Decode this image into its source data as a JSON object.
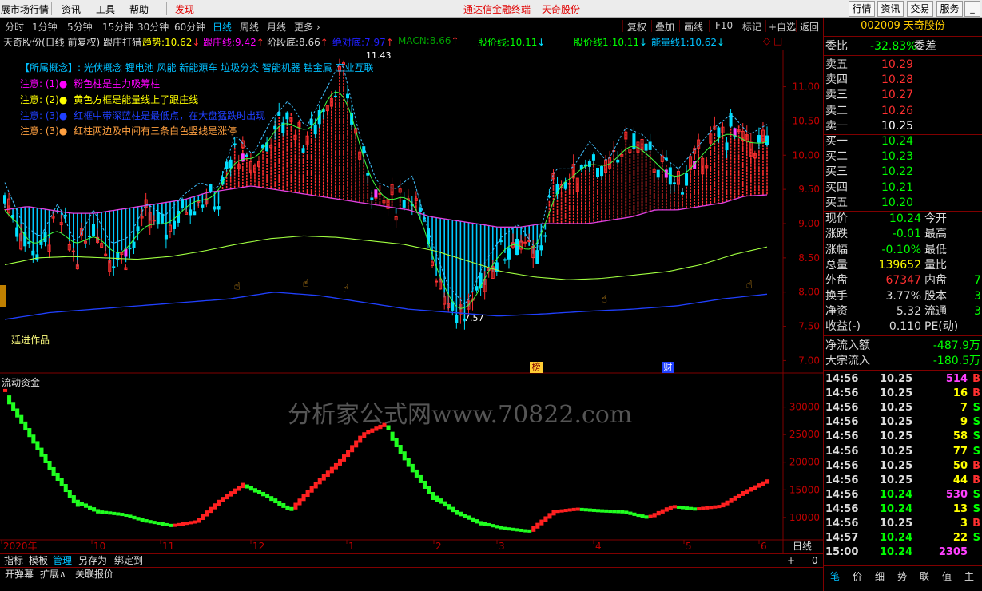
{
  "menubar": {
    "items": [
      "展市场行情",
      "资讯",
      "工具",
      "帮助",
      "发现"
    ],
    "center_title": "通达信金融终端",
    "stock_title": "天奇股份",
    "right_buttons": [
      "行情",
      "资讯",
      "交易",
      "服务"
    ],
    "window_controls": [
      "_",
      "□",
      "×"
    ]
  },
  "toolbar": {
    "periods": [
      "分时",
      "1分钟",
      "5分钟",
      "15分钟",
      "30分钟",
      "60分钟",
      "日线",
      "周线",
      "月线",
      "更多 ›"
    ],
    "active_period": "日线",
    "right": [
      "复权",
      "叠加",
      "画线",
      "F10",
      "标记",
      "+自选",
      "返回"
    ]
  },
  "indicator_line": {
    "name": "天奇股份(日线 前复权) 跟庄打猎",
    "items": [
      {
        "label": "趋势:",
        "value": "10.62",
        "arrow": "↓"
      },
      {
        "label": "跟庄线:",
        "value": "9.42",
        "arrow": "↑"
      },
      {
        "label": "阶段底:",
        "value": "8.66",
        "arrow": "↑"
      },
      {
        "label": "绝对底:",
        "value": "7.97",
        "arrow": "↑"
      },
      {
        "label": "MACN:",
        "value": "8.66",
        "arrow": "↑"
      },
      {
        "label": "股价线:",
        "value": "10.11",
        "arrow": "↓"
      },
      {
        "label": "股价线1:",
        "value": "10.11",
        "arrow": "↓"
      },
      {
        "label": "能量线1:",
        "value": "10.62",
        "arrow": "↓"
      }
    ]
  },
  "notes": {
    "concepts": "【所属概念】: 光伏概念 锂电池 风能 新能源车 垃圾分类 智能机器 钴金属 工业互联",
    "n1": "注意: (1)●",
    "t1": "粉色柱是主力吸筹柱",
    "n2": "注意: (2)●",
    "t2": "黄色方框是能量线上了跟庄线",
    "n3": "注意: (3)●",
    "t3": "红框中带深蓝柱是最低点，在大盘猛跌时出现",
    "n4": "注意: (3)●",
    "t4": "红柱两边及中间有三条白色竖线是涨停",
    "author": "廷进作品"
  },
  "main_chart": {
    "y_ticks": [
      "11.00",
      "10.50",
      "10.00",
      "9.50",
      "9.00",
      "8.50",
      "8.00",
      "7.50",
      "7.00"
    ],
    "y_range": [
      6.9,
      11.45
    ],
    "high_label": "11.43",
    "low_label": "7.57",
    "markers": [
      "榜",
      "财"
    ]
  },
  "sub_chart": {
    "title": "流动资金",
    "y_ticks": [
      "30000",
      "25000",
      "20000",
      "15000",
      "10000"
    ],
    "y_range": [
      6500,
      34000
    ],
    "watermark": "分析家公式网www.70822.com"
  },
  "x_axis": {
    "labels": [
      "2020年",
      "10",
      "11",
      "12",
      "1",
      "2",
      "3",
      "4",
      "5",
      "6"
    ],
    "period": "日线"
  },
  "bottom_tabs": [
    "指标",
    "模板",
    "管理",
    "另存为",
    "绑定到"
  ],
  "bottom_tabs2": [
    "开弹幕",
    "扩展∧",
    "关联报价"
  ],
  "zoom_controls": [
    "+",
    "-",
    "0"
  ],
  "quote": {
    "code": "002009",
    "name": "天奇股份",
    "weibi_label": "委比",
    "weibi": "-32.83%",
    "weicha_label": "委差",
    "asks": [
      {
        "label": "卖五",
        "price": "10.29"
      },
      {
        "label": "卖四",
        "price": "10.28"
      },
      {
        "label": "卖三",
        "price": "10.27"
      },
      {
        "label": "卖二",
        "price": "10.26"
      },
      {
        "label": "卖一",
        "price": "10.25"
      }
    ],
    "bids": [
      {
        "label": "买一",
        "price": "10.24"
      },
      {
        "label": "买二",
        "price": "10.23"
      },
      {
        "label": "买三",
        "price": "10.22"
      },
      {
        "label": "买四",
        "price": "10.21"
      },
      {
        "label": "买五",
        "price": "10.20"
      }
    ],
    "stats": [
      {
        "l": "现价",
        "v": "10.24",
        "l2": "今开",
        "v2": ""
      },
      {
        "l": "涨跌",
        "v": "-0.01",
        "l2": "最高",
        "v2": ""
      },
      {
        "l": "涨幅",
        "v": "-0.10%",
        "l2": "最低",
        "v2": ""
      },
      {
        "l": "总量",
        "v": "139652",
        "l2": "量比",
        "v2": ""
      },
      {
        "l": "外盘",
        "v": "67347",
        "l2": "内盘",
        "v2": "7"
      },
      {
        "l": "换手",
        "v": "3.77%",
        "l2": "股本",
        "v2": "3."
      },
      {
        "l": "净资",
        "v": "5.32",
        "l2": "流通",
        "v2": "3."
      },
      {
        "l": "收益(-)",
        "v": "0.110",
        "l2": "PE(动)",
        "v2": ""
      }
    ],
    "netflow_label": "净流入额",
    "netflow": "-487.9万",
    "block_label": "大宗流入",
    "block": "-180.5万",
    "ticks": [
      {
        "t": "14:56",
        "p": "10.25",
        "v": "514",
        "d": "B"
      },
      {
        "t": "14:56",
        "p": "10.25",
        "v": "16",
        "d": "B"
      },
      {
        "t": "14:56",
        "p": "10.25",
        "v": "7",
        "d": "S"
      },
      {
        "t": "14:56",
        "p": "10.25",
        "v": "9",
        "d": "S"
      },
      {
        "t": "14:56",
        "p": "10.25",
        "v": "58",
        "d": "S"
      },
      {
        "t": "14:56",
        "p": "10.25",
        "v": "77",
        "d": "S"
      },
      {
        "t": "14:56",
        "p": "10.25",
        "v": "50",
        "d": "B"
      },
      {
        "t": "14:56",
        "p": "10.25",
        "v": "44",
        "d": "B"
      },
      {
        "t": "14:56",
        "p": "10.24",
        "v": "530",
        "d": "S"
      },
      {
        "t": "14:56",
        "p": "10.24",
        "v": "13",
        "d": "S"
      },
      {
        "t": "14:56",
        "p": "10.25",
        "v": "3",
        "d": "B"
      },
      {
        "t": "14:57",
        "p": "10.24",
        "v": "22",
        "d": "S"
      },
      {
        "t": "15:00",
        "p": "10.24",
        "v": "2305",
        "d": ""
      }
    ],
    "bottom_tabs": [
      "笔",
      "价",
      "细",
      "势",
      "联",
      "值",
      "主"
    ]
  },
  "colors": {
    "up": "#ff3030",
    "down": "#00e0ff",
    "green": "#00ff00",
    "yellow": "#ffff00",
    "magenta": "#ff00ff",
    "white": "#ffffff",
    "grid": "#800000"
  },
  "chart_data": {
    "type": "line",
    "title": "天奇股份(日线 前复权)",
    "series": [
      {
        "name": "股价线",
        "values": [
          9.4,
          8.8,
          8.6,
          9.1,
          8.5,
          9.0,
          8.5,
          8.6,
          9.1,
          8.9,
          9.2,
          9.4,
          9.3,
          10.1,
          9.8,
          10.3,
          10.6,
          10.2,
          10.7,
          11.2,
          10.1,
          9.4,
          9.3,
          9.5,
          8.6,
          7.9,
          7.6,
          8.2,
          8.6,
          8.8,
          8.4,
          9.6,
          9.6,
          10.0,
          9.7,
          10.2,
          10.1,
          9.8,
          9.6,
          9.9,
          10.2,
          10.4,
          10.1,
          10.25
        ]
      },
      {
        "name": "跟庄线",
        "values": [
          9.2,
          9.25,
          9.2,
          9.15,
          9.15,
          9.2,
          9.25,
          9.3,
          9.35,
          9.45,
          9.5,
          9.55,
          9.5,
          9.45,
          9.4,
          9.35,
          9.3,
          9.25,
          9.2,
          9.1,
          9.05,
          9.0,
          8.95,
          8.95,
          9.0,
          9.0,
          9.0,
          9.05,
          9.1,
          9.2,
          9.2,
          9.25,
          9.3,
          9.4,
          9.42
        ]
      },
      {
        "name": "阶段底",
        "values": [
          8.4,
          8.5,
          8.52,
          8.5,
          8.48,
          8.52,
          8.6,
          8.7,
          8.78,
          8.82,
          8.8,
          8.75,
          8.7,
          8.6,
          8.45,
          8.3,
          8.22,
          8.18,
          8.2,
          8.25,
          8.3,
          8.4,
          8.55,
          8.66
        ]
      },
      {
        "name": "绝对底",
        "values": [
          7.6,
          7.7,
          7.75,
          7.8,
          7.85,
          7.9,
          8.0,
          7.95,
          7.85,
          7.75,
          7.7,
          7.65,
          7.68,
          7.72,
          7.75,
          7.8,
          7.9,
          7.97
        ]
      },
      {
        "name": "流动资金",
        "values": [
          33000,
          26000,
          19000,
          13000,
          11000,
          10500,
          9300,
          8500,
          9200,
          13000,
          16000,
          14000,
          11500,
          16000,
          20000,
          25000,
          27000,
          20000,
          14000,
          11000,
          9000,
          8000,
          7500,
          11000,
          11500,
          11200,
          11000,
          10000,
          12000,
          11500,
          12000,
          14500,
          16600
        ]
      }
    ],
    "ylim": [
      6.9,
      11.45
    ]
  }
}
